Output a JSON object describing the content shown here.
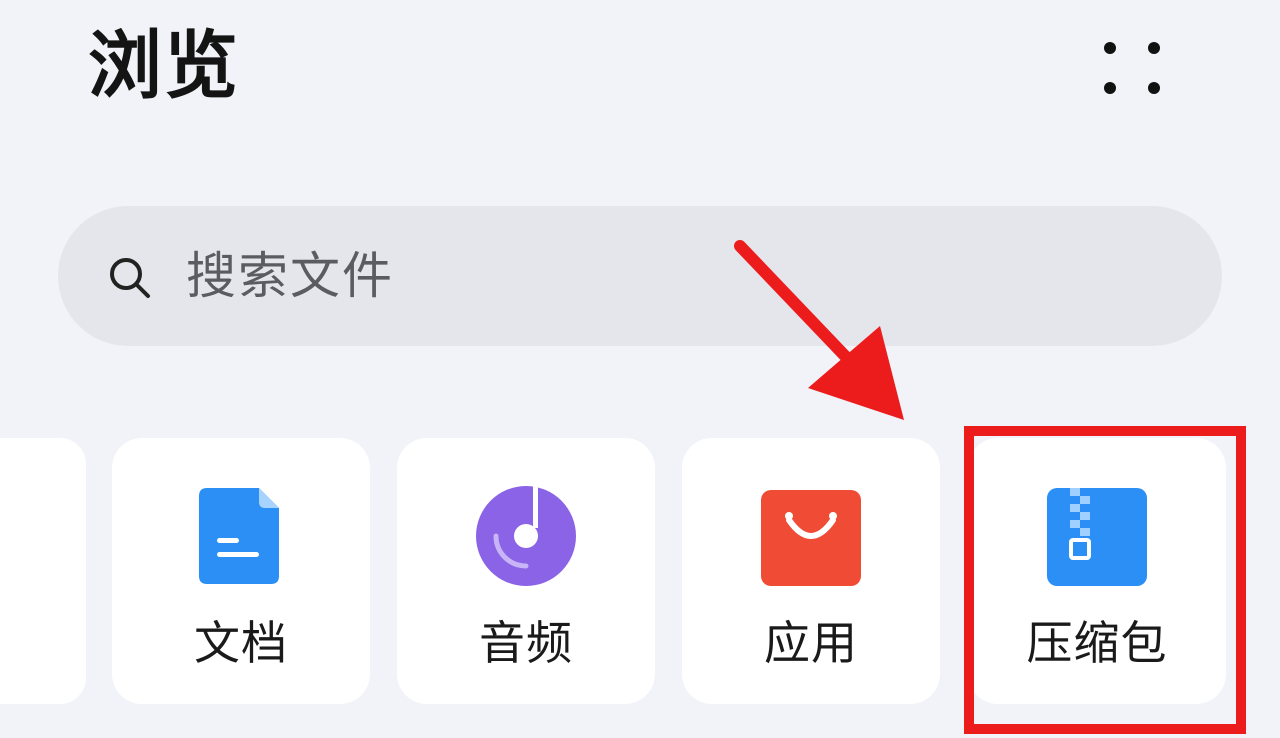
{
  "header": {
    "title": "浏览",
    "more_icon": "grid-dots-icon"
  },
  "search": {
    "placeholder": "搜索文件",
    "icon": "search-icon"
  },
  "categories": [
    {
      "label": "文档",
      "icon": "document-icon",
      "color": "#2b8ff5"
    },
    {
      "label": "音频",
      "icon": "audio-disc-icon",
      "color": "#8a63e6"
    },
    {
      "label": "应用",
      "icon": "shopping-bag-icon",
      "color": "#f04b35"
    },
    {
      "label": "压缩包",
      "icon": "zip-archive-icon",
      "color": "#2b8ff5"
    }
  ],
  "annotation": {
    "color": "#ec1c1c",
    "highlighted_item": "压缩包"
  }
}
